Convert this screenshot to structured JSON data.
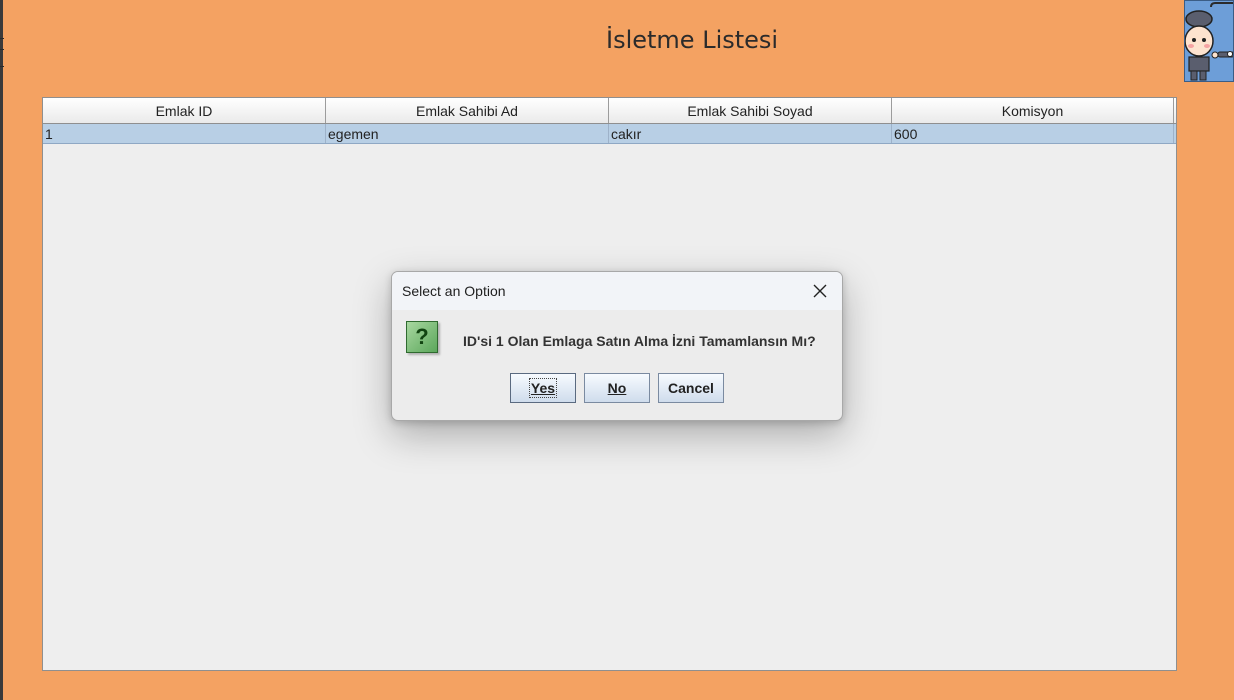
{
  "window": {
    "title": "İsletme Listesi"
  },
  "table": {
    "columns": [
      "Emlak ID",
      "Emlak Sahibi Ad",
      "Emlak Sahibi Soyad",
      "Komisyon"
    ],
    "rows": [
      [
        "1",
        "egemen",
        "cakır",
        "600"
      ]
    ],
    "selected_row_color": "#b8cfe5"
  },
  "dialog": {
    "title": "Select an Option",
    "message": "ID'si 1 Olan Emlaga Satın Alma İzni Tamamlansın Mı?",
    "icon": "question-icon",
    "buttons": {
      "yes": "Yes",
      "no": "No",
      "cancel": "Cancel"
    }
  },
  "colors": {
    "background": "#f4a262",
    "panel": "#eeeeee"
  }
}
